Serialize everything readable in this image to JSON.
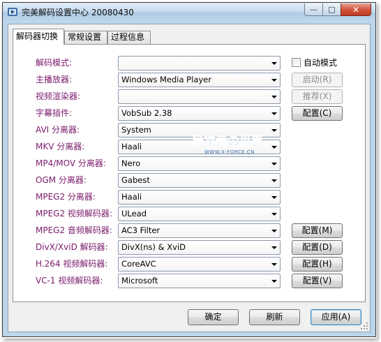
{
  "window": {
    "title": "完美解码设置中心 20080430",
    "controls": {
      "minimize": "—",
      "maximize": "□",
      "close": "✕"
    }
  },
  "tabs": [
    {
      "label": "解码器切换",
      "active": true
    },
    {
      "label": "常规设置",
      "active": false
    },
    {
      "label": "过程信息",
      "active": false
    }
  ],
  "rows": [
    {
      "label": "解码模式:",
      "value": "",
      "button": ""
    },
    {
      "label": "主播放器:",
      "value": "Windows Media Player",
      "button": "启动(R)",
      "button_disabled": true
    },
    {
      "label": "视频渲染器:",
      "value": "",
      "button": "推荐(X)",
      "button_disabled": true
    },
    {
      "label": "字幕插件:",
      "value": "VobSub 2.38",
      "button": "配置(C)",
      "button_disabled": false
    },
    {
      "label": "AVI 分离器:",
      "value": "System",
      "button": ""
    },
    {
      "label": "MKV 分离器:",
      "value": "Haali",
      "button": ""
    },
    {
      "label": "MP4/MOV 分离器:",
      "value": "Nero",
      "button": ""
    },
    {
      "label": "OGM 分离器:",
      "value": "Gabest",
      "button": ""
    },
    {
      "label": "MPEG2 分离器:",
      "value": "Haali",
      "button": ""
    },
    {
      "label": "MPEG2 视频解码器:",
      "value": "ULead",
      "button": ""
    },
    {
      "label": "MPEG2 音频解码器:",
      "value": "AC3 Filter",
      "button": "配置(M)",
      "button_disabled": false
    },
    {
      "label": "DivX/XviD 解码器:",
      "value": "DivX(ns) & XviD",
      "button": "配置(D)",
      "button_disabled": false
    },
    {
      "label": "H.264 视频解码器:",
      "value": "CoreAVC",
      "button": "配置(H)",
      "button_disabled": false
    },
    {
      "label": "VC-1 视频解码器:",
      "value": "Microsoft",
      "button": "配置(V)",
      "button_disabled": false
    }
  ],
  "auto_mode": {
    "label": "自动模式",
    "checked": false
  },
  "watermark": {
    "cn": "异次元の世界",
    "en": "WWW.X-FORCE.CN"
  },
  "footer": {
    "ok": "确定",
    "refresh": "刷新",
    "apply": "应用(A)"
  },
  "colors": {
    "label_text": "#7a1a6a",
    "window_frame": "#bcd5e9",
    "close_button": "#c9472f"
  }
}
